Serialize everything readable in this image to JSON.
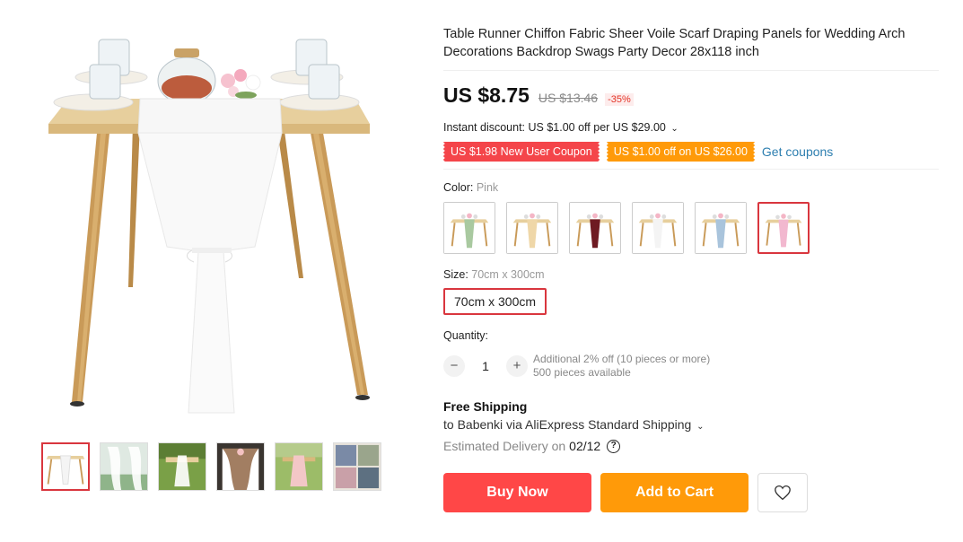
{
  "product": {
    "title": "Table Runner Chiffon Fabric Sheer Voile Scarf Draping Panels for Wedding Arch Decorations Backdrop Swags Party Decor 28x118 inch"
  },
  "price": {
    "current": "US $8.75",
    "original": "US $13.46",
    "discount_pct": "-35%"
  },
  "instant_discount": "Instant discount: US $1.00 off per US $29.00",
  "coupons": {
    "new_user": "US $1.98 New User Coupon",
    "store": "US $1.00 off on US $26.00",
    "get_label": "Get coupons"
  },
  "color": {
    "label": "Color:",
    "selected": "Pink",
    "options": [
      {
        "name": "Sage Green",
        "cloth": "#a9c9a0"
      },
      {
        "name": "Champagne",
        "cloth": "#efd7a8"
      },
      {
        "name": "Burgundy",
        "cloth": "#6e1a22"
      },
      {
        "name": "White",
        "cloth": "#f4f4f4"
      },
      {
        "name": "Dusty Blue",
        "cloth": "#a9c4dc"
      },
      {
        "name": "Pink",
        "cloth": "#f2b8cf"
      }
    ]
  },
  "size": {
    "label": "Size:",
    "selected": "70cm x 300cm",
    "option": "70cm x 300cm"
  },
  "quantity": {
    "label": "Quantity:",
    "value": "1",
    "minus": "−",
    "plus": "+",
    "bulk_note": "Additional 2% off (10 pieces or more)",
    "available": "500 pieces available"
  },
  "shipping": {
    "title": "Free Shipping",
    "to": "to Babenki via AliExpress Standard Shipping",
    "delivery_label": "Estimated Delivery on",
    "delivery_date": "02/12"
  },
  "actions": {
    "buy_now": "Buy Now",
    "add_to_cart": "Add to Cart"
  },
  "colors": {
    "accent": "#ff4747",
    "orange": "#ff9a09",
    "selected_border": "#d9363e",
    "link": "#2e7fb0"
  }
}
